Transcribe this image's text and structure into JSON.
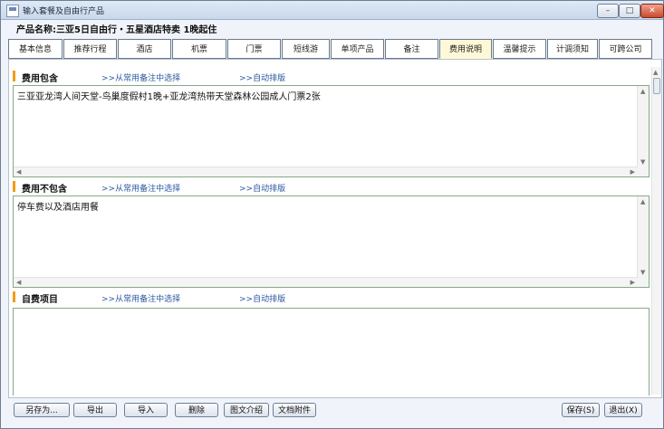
{
  "window": {
    "title": "输入套餐及自由行产品",
    "min_label": "–",
    "max_label": "□",
    "close_label": "✕"
  },
  "product": {
    "label": "产品名称:",
    "name": "三亚5日自由行・五星酒店特卖 1晚起住"
  },
  "tabs": [
    {
      "label": "基本信息",
      "active": false
    },
    {
      "label": "推荐行程",
      "active": false
    },
    {
      "label": "酒店",
      "active": false
    },
    {
      "label": "机票",
      "active": false
    },
    {
      "label": "门票",
      "active": false
    },
    {
      "label": "短线游",
      "active": false
    },
    {
      "label": "单项产品",
      "active": false
    },
    {
      "label": "备注",
      "active": false
    },
    {
      "label": "费用说明",
      "active": true
    },
    {
      "label": "温馨提示",
      "active": false
    },
    {
      "label": "计调须知",
      "active": false
    },
    {
      "label": "可跨公司",
      "active": false
    }
  ],
  "sections": {
    "included": {
      "title": "费用包含",
      "link_select": ">>从常用备注中选择",
      "link_auto": ">>自动排版",
      "text": "三亚亚龙湾人间天堂-鸟巢度假村1晚+亚龙湾热带天堂森林公园成人门票2张"
    },
    "excluded": {
      "title": "费用不包含",
      "link_select": ">>从常用备注中选择",
      "link_auto": ">>自动排版",
      "text": "停车费以及酒店用餐"
    },
    "self_paid": {
      "title": "自费项目",
      "link_select": ">>从常用备注中选择",
      "link_auto": ">>自动排版",
      "text": ""
    }
  },
  "buttons": {
    "save_as": "另存为...",
    "export": "导出",
    "import": "导入",
    "delete": "删除",
    "image_text": "图文介绍",
    "doc_attach": "文档附件",
    "save": "保存(S)",
    "exit": "退出(X)"
  },
  "colors": {
    "accent_marker": "#f39c12",
    "link": "#2c5aa0",
    "active_tab": "#fff8d6"
  }
}
